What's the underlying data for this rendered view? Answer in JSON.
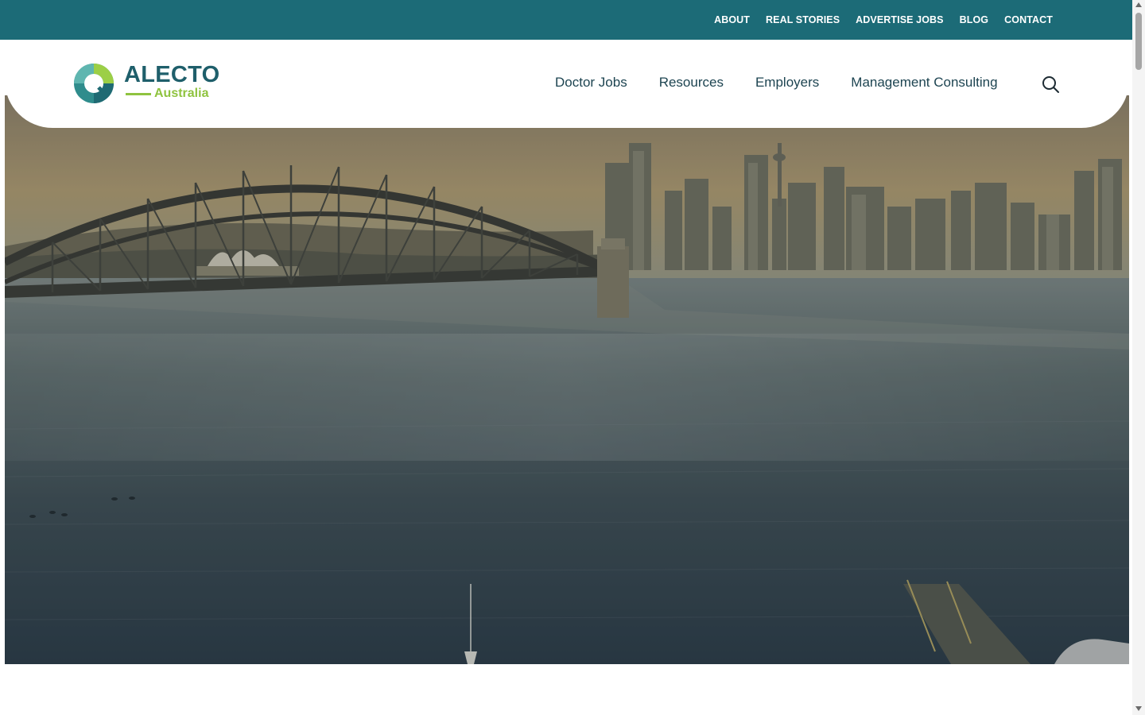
{
  "top_nav": {
    "items": [
      "ABOUT",
      "REAL STORIES",
      "ADVERTISE JOBS",
      "BLOG",
      "CONTACT"
    ]
  },
  "logo": {
    "primary": "ALECTO",
    "secondary": "Australia"
  },
  "main_nav": {
    "items": [
      "Doctor Jobs",
      "Resources",
      "Employers",
      "Management Consulting"
    ]
  },
  "search": {
    "icon": "search-icon"
  },
  "hero": {
    "image_description": "Aerial view of Sydney Harbour Bridge and city skyline at dusk"
  },
  "colors": {
    "topbar": "#1c6b77",
    "logo_primary": "#1f5f6b",
    "logo_accent": "#8fc33f",
    "nav_text": "#1d4451"
  }
}
